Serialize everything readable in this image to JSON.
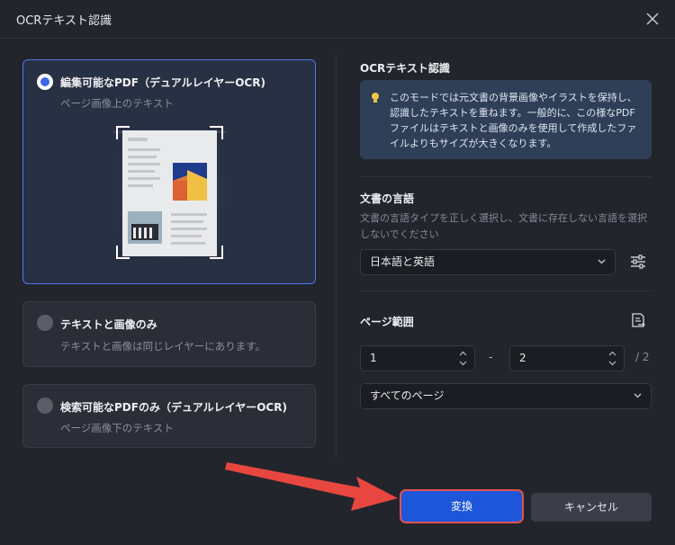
{
  "dialog": {
    "title": "OCRテキスト認識"
  },
  "options": [
    {
      "label": "編集可能なPDF（デュアルレイヤーOCR)",
      "sub": "ページ画像上のテキスト",
      "selected": true
    },
    {
      "label": "テキストと画像のみ",
      "sub": "テキストと画像は同じレイヤーにあります。",
      "selected": false
    },
    {
      "label": "検索可能なPDFのみ（デュアルレイヤーOCR)",
      "sub": "ページ画像下のテキスト",
      "selected": false
    }
  ],
  "right": {
    "ocr_title": "OCRテキスト認識",
    "info": "このモードでは元文書の背景画像やイラストを保持し、認識したテキストを重ねます。一般的に、この様なPDFファイルはテキストと画像のみを使用して作成したファイルよりもサイズが大きくなります。",
    "lang_title": "文書の言語",
    "lang_desc": "文書の言語タイプを正しく選択し、文書に存在しない言語を選択しないでください",
    "lang_value": "日本語と英語",
    "range_title": "ページ範囲",
    "from": "1",
    "dash": "-",
    "to": "2",
    "total": "/ 2",
    "pages_value": "すべてのページ"
  },
  "buttons": {
    "convert": "変換",
    "cancel": "キャンセル"
  },
  "colors": {
    "accent": "#1e56d9",
    "highlight": "#e0534f",
    "selected_border": "#4e76f0"
  }
}
